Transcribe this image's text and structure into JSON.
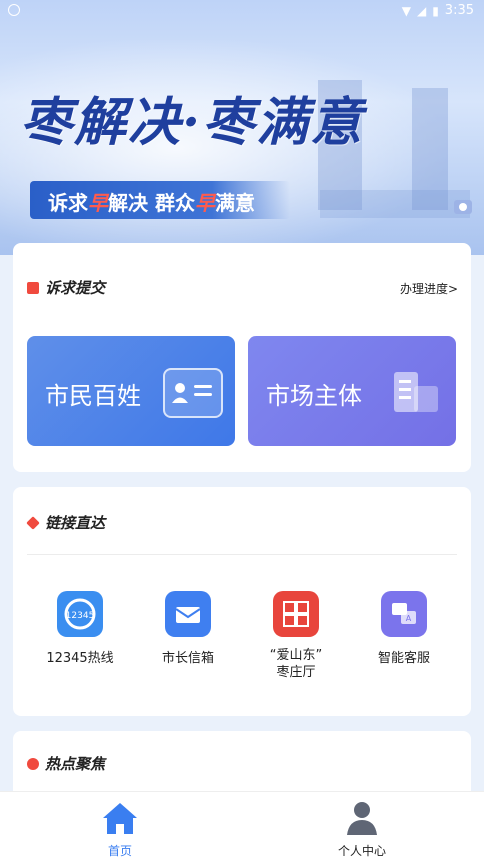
{
  "status_bar": {
    "time": "3:35"
  },
  "banner": {
    "slogan_main": "枣解决·枣满意",
    "slogan_sub": {
      "part1": "诉求",
      "hl1": "早",
      "part2": "解决 群众",
      "hl2": "早",
      "part3": "满意"
    }
  },
  "submit_section": {
    "title": "诉求提交",
    "progress_link": "办理进度>",
    "tiles": [
      {
        "label": "市民百姓",
        "icon": "id-card-icon"
      },
      {
        "label": "市场主体",
        "icon": "building-icon"
      }
    ]
  },
  "links_section": {
    "title": "链接直达",
    "items": [
      {
        "label": "12345热线",
        "icon": "hotline-12345-icon",
        "color": "#3a8ef0"
      },
      {
        "label": "市长信箱",
        "icon": "mail-icon",
        "color": "#3f7ff0"
      },
      {
        "label": "“爱山东”\n枣庄厅",
        "icon": "aishandong-logo-icon",
        "color": "#e8453c"
      },
      {
        "label": "智能客服",
        "icon": "chat-translate-icon",
        "color": "#7b74ec"
      }
    ]
  },
  "hot_section": {
    "title": "热点聚焦"
  },
  "tab_bar": {
    "tabs": [
      {
        "label": "首页",
        "icon": "home-icon",
        "active": true,
        "color": "#3a7ef0"
      },
      {
        "label": "个人中心",
        "icon": "person-icon",
        "active": false,
        "color": "#222222"
      }
    ]
  }
}
